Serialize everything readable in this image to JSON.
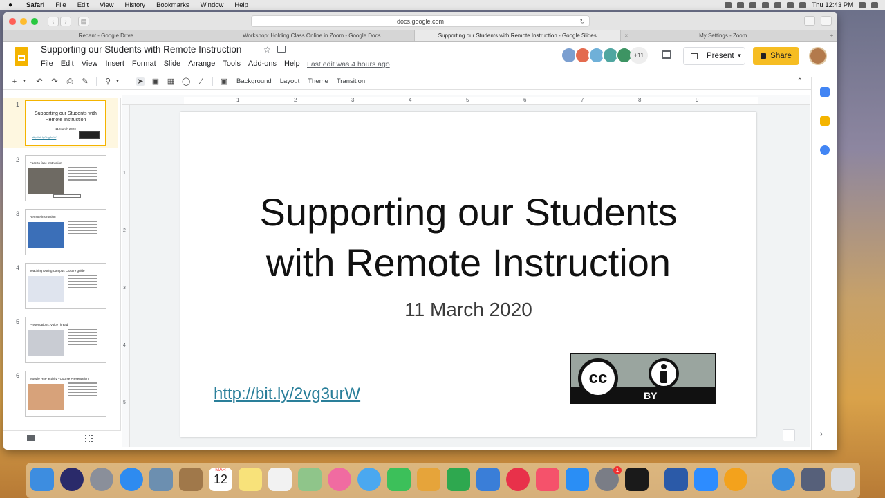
{
  "menubar": {
    "apple": "",
    "items": [
      "Safari",
      "File",
      "Edit",
      "View",
      "History",
      "Bookmarks",
      "Window",
      "Help"
    ],
    "clock": "Thu 12:43 PM"
  },
  "safari": {
    "url": "docs.google.com",
    "tabs": [
      {
        "label": "Recent - Google Drive"
      },
      {
        "label": "Workshop: Holding Class Online in Zoom - Google Docs"
      },
      {
        "label": "Supporting our Students with Remote Instruction - Google Slides",
        "active": true
      },
      {
        "label": "My Settings - Zoom"
      }
    ]
  },
  "slides_app": {
    "title": "Supporting our Students with Remote Instruction",
    "menus": [
      "File",
      "Edit",
      "View",
      "Insert",
      "Format",
      "Slide",
      "Arrange",
      "Tools",
      "Add-ons",
      "Help"
    ],
    "last_edit": "Last edit was 4 hours ago",
    "collaborator_count": "+11",
    "present_label": "Present",
    "share_label": "Share"
  },
  "toolbar": {
    "background_label": "Background",
    "layout_label": "Layout",
    "theme_label": "Theme",
    "transition_label": "Transition"
  },
  "ruler": {
    "h_ticks": [
      "1",
      "2",
      "3",
      "4",
      "5",
      "6",
      "7",
      "8",
      "9"
    ],
    "v_ticks": [
      "1",
      "2",
      "3",
      "4",
      "5"
    ]
  },
  "filmstrip": [
    {
      "num": "1",
      "title": "Supporting our Students with Remote Instruction",
      "date": "11 March 2020",
      "link": "http://bit.ly/2vg3urW"
    },
    {
      "num": "2",
      "title": "Face to face instruction"
    },
    {
      "num": "3",
      "title": "Remote instruction"
    },
    {
      "num": "4",
      "title": "Teaching During Campus Closure guide"
    },
    {
      "num": "5",
      "title": "Presentations: VoiceThread"
    },
    {
      "num": "6",
      "title": "Moodle H5P activity - Course Presentation"
    }
  ],
  "slide": {
    "title_line1": "Supporting our Students",
    "title_line2": "with Remote Instruction",
    "date": "11 March 2020",
    "link": "http://bit.ly/2vg3urW",
    "license_cc": "cc",
    "license_by": "BY"
  },
  "dock": {
    "calendar_month": "MAR",
    "calendar_day": "12",
    "badge": "1"
  },
  "colors": {
    "slides_yellow": "#f4b400",
    "share_yellow": "#f6bd22",
    "link": "#2a7f9a"
  }
}
